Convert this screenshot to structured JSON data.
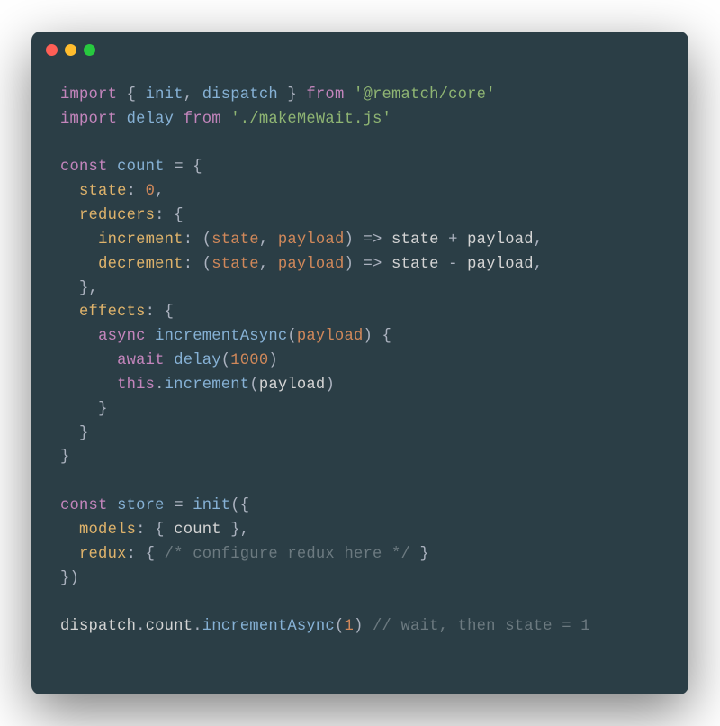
{
  "titlebar": {
    "dot_red_color": "#ff5f56",
    "dot_yellow_color": "#ffbd2e",
    "dot_green_color": "#27c93f"
  },
  "code": {
    "l1": {
      "kw1": "import",
      "p1": " { ",
      "id1": "init",
      "p2": ", ",
      "id2": "dispatch",
      "p3": " } ",
      "kw2": "from",
      "sp": " ",
      "str": "'@rematch/core'"
    },
    "l2": {
      "kw1": "import",
      "sp": " ",
      "id1": "delay",
      "sp2": " ",
      "kw2": "from",
      "sp3": " ",
      "str": "'./makeMeWait.js'"
    },
    "l4": {
      "kw1": "const",
      "sp": " ",
      "id1": "count",
      "sp2": " ",
      "eq": "=",
      "sp3": " ",
      "brace": "{"
    },
    "l5": {
      "indent": "  ",
      "prop": "state",
      "colon": ": ",
      "num": "0",
      "comma": ","
    },
    "l6": {
      "indent": "  ",
      "prop": "reducers",
      "colon": ": ",
      "brace": "{"
    },
    "l7": {
      "indent": "    ",
      "prop": "increment",
      "colon": ": ",
      "lp": "(",
      "p1": "state",
      "comma": ", ",
      "p2": "payload",
      "rp": ")",
      "arrow": " => ",
      "expr": "state + payload,",
      "s1": "state",
      "op": " + ",
      "s2": "payload",
      "tc": ","
    },
    "l8": {
      "indent": "    ",
      "prop": "decrement",
      "colon": ": ",
      "lp": "(",
      "p1": "state",
      "comma": ", ",
      "p2": "payload",
      "rp": ")",
      "arrow": " => ",
      "s1": "state",
      "op": " - ",
      "s2": "payload",
      "tc": ","
    },
    "l9": {
      "indent": "  ",
      "brace": "}",
      "comma": ","
    },
    "l10": {
      "indent": "  ",
      "prop": "effects",
      "colon": ": ",
      "brace": "{"
    },
    "l11": {
      "indent": "    ",
      "kw": "async",
      "sp": " ",
      "fn": "incrementAsync",
      "lp": "(",
      "p1": "payload",
      "rp": ")",
      "brace": " {"
    },
    "l12": {
      "indent": "      ",
      "kw": "await",
      "sp": " ",
      "fn": "delay",
      "lp": "(",
      "num": "1000",
      "rp": ")"
    },
    "l13": {
      "indent": "      ",
      "kw": "this",
      "dot": ".",
      "fn": "increment",
      "lp": "(",
      "arg": "payload",
      "rp": ")"
    },
    "l14": {
      "indent": "    ",
      "brace": "}"
    },
    "l15": {
      "indent": "  ",
      "brace": "}"
    },
    "l16": {
      "brace": "}"
    },
    "l18": {
      "kw1": "const",
      "sp": " ",
      "id1": "store",
      "sp2": " ",
      "eq": "=",
      "sp3": " ",
      "fn": "init",
      "lp": "(",
      "brace": "{"
    },
    "l19": {
      "indent": "  ",
      "prop": "models",
      "colon": ": ",
      "lb": "{ ",
      "id": "count",
      "rb": " }",
      "comma": ","
    },
    "l20": {
      "indent": "  ",
      "prop": "redux",
      "colon": ": ",
      "lb": "{ ",
      "comment": "/* configure redux here */",
      "rb": " }"
    },
    "l21": {
      "brace": "})"
    },
    "l23": {
      "id1": "dispatch",
      "dot1": ".",
      "id2": "count",
      "dot2": ".",
      "fn": "incrementAsync",
      "lp": "(",
      "num": "1",
      "rp": ")",
      "sp": " ",
      "comment": "// wait, then state = 1"
    }
  }
}
